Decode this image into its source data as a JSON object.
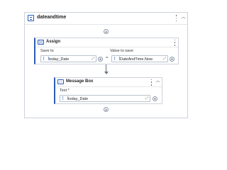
{
  "sequence": {
    "title": "dateandtime"
  },
  "assign": {
    "title": "Assign",
    "icon_text": "(x)",
    "save_to_label": "Save to",
    "value_label": "Value to save",
    "save_to_value": "today_Date",
    "value_value": "DateAndTime.Now",
    "equals": "="
  },
  "message_box": {
    "title": "Message Box",
    "text_label": "Text *",
    "text_value": "today_Date"
  },
  "common": {
    "bracket": "[ ]",
    "expand": "⤢",
    "collapse": "︿"
  }
}
